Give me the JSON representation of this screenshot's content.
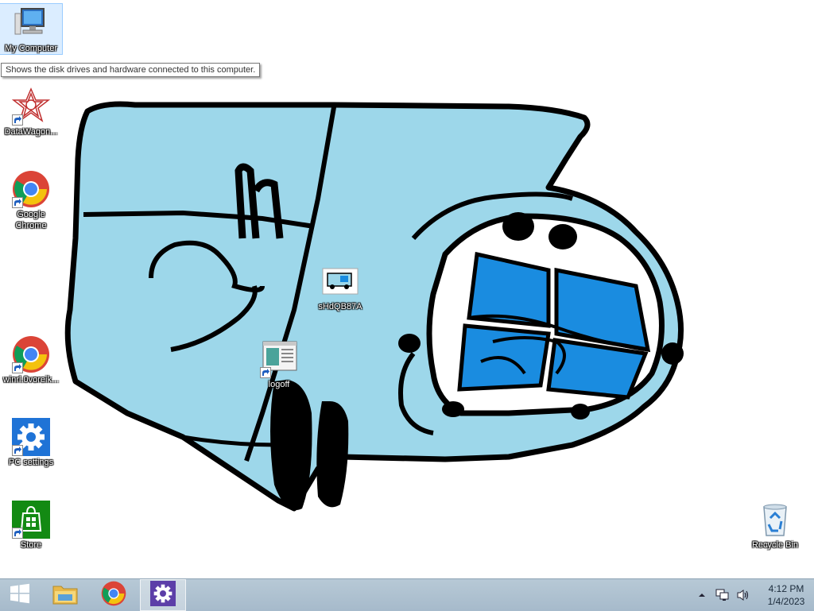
{
  "desktop": {
    "icons": [
      {
        "label": "My Computer"
      },
      {
        "label": "DataWagon..."
      },
      {
        "label": "Google Chrome"
      },
      {
        "label": "winrl.0voreik..."
      },
      {
        "label": "PC settings"
      },
      {
        "label": "Store"
      },
      {
        "label": "sHdQB87A"
      },
      {
        "label": "logoff"
      },
      {
        "label": "Recycle Bin"
      }
    ],
    "tooltip": "Shows the disk drives and hardware connected to this computer."
  },
  "taskbar": {
    "start": {
      "icon": "windows-logo-icon"
    },
    "pinned": [
      {
        "icon": "file-explorer-icon"
      },
      {
        "icon": "chrome-icon"
      },
      {
        "icon": "settings-gear-icon",
        "active": true
      }
    ],
    "tray": {
      "icons": [
        "show-hidden-icons-chevron-icon",
        "network-icon",
        "volume-icon"
      ],
      "time": "4:12 PM",
      "date": "1/4/2023"
    }
  },
  "colors": {
    "taskbar": "#a6bacb",
    "wallpaper_truck": "#9dd7ea",
    "wallpaper_window": "#1a8ce0",
    "store_green": "#138a13",
    "settings_blue": "#1f73d6"
  }
}
